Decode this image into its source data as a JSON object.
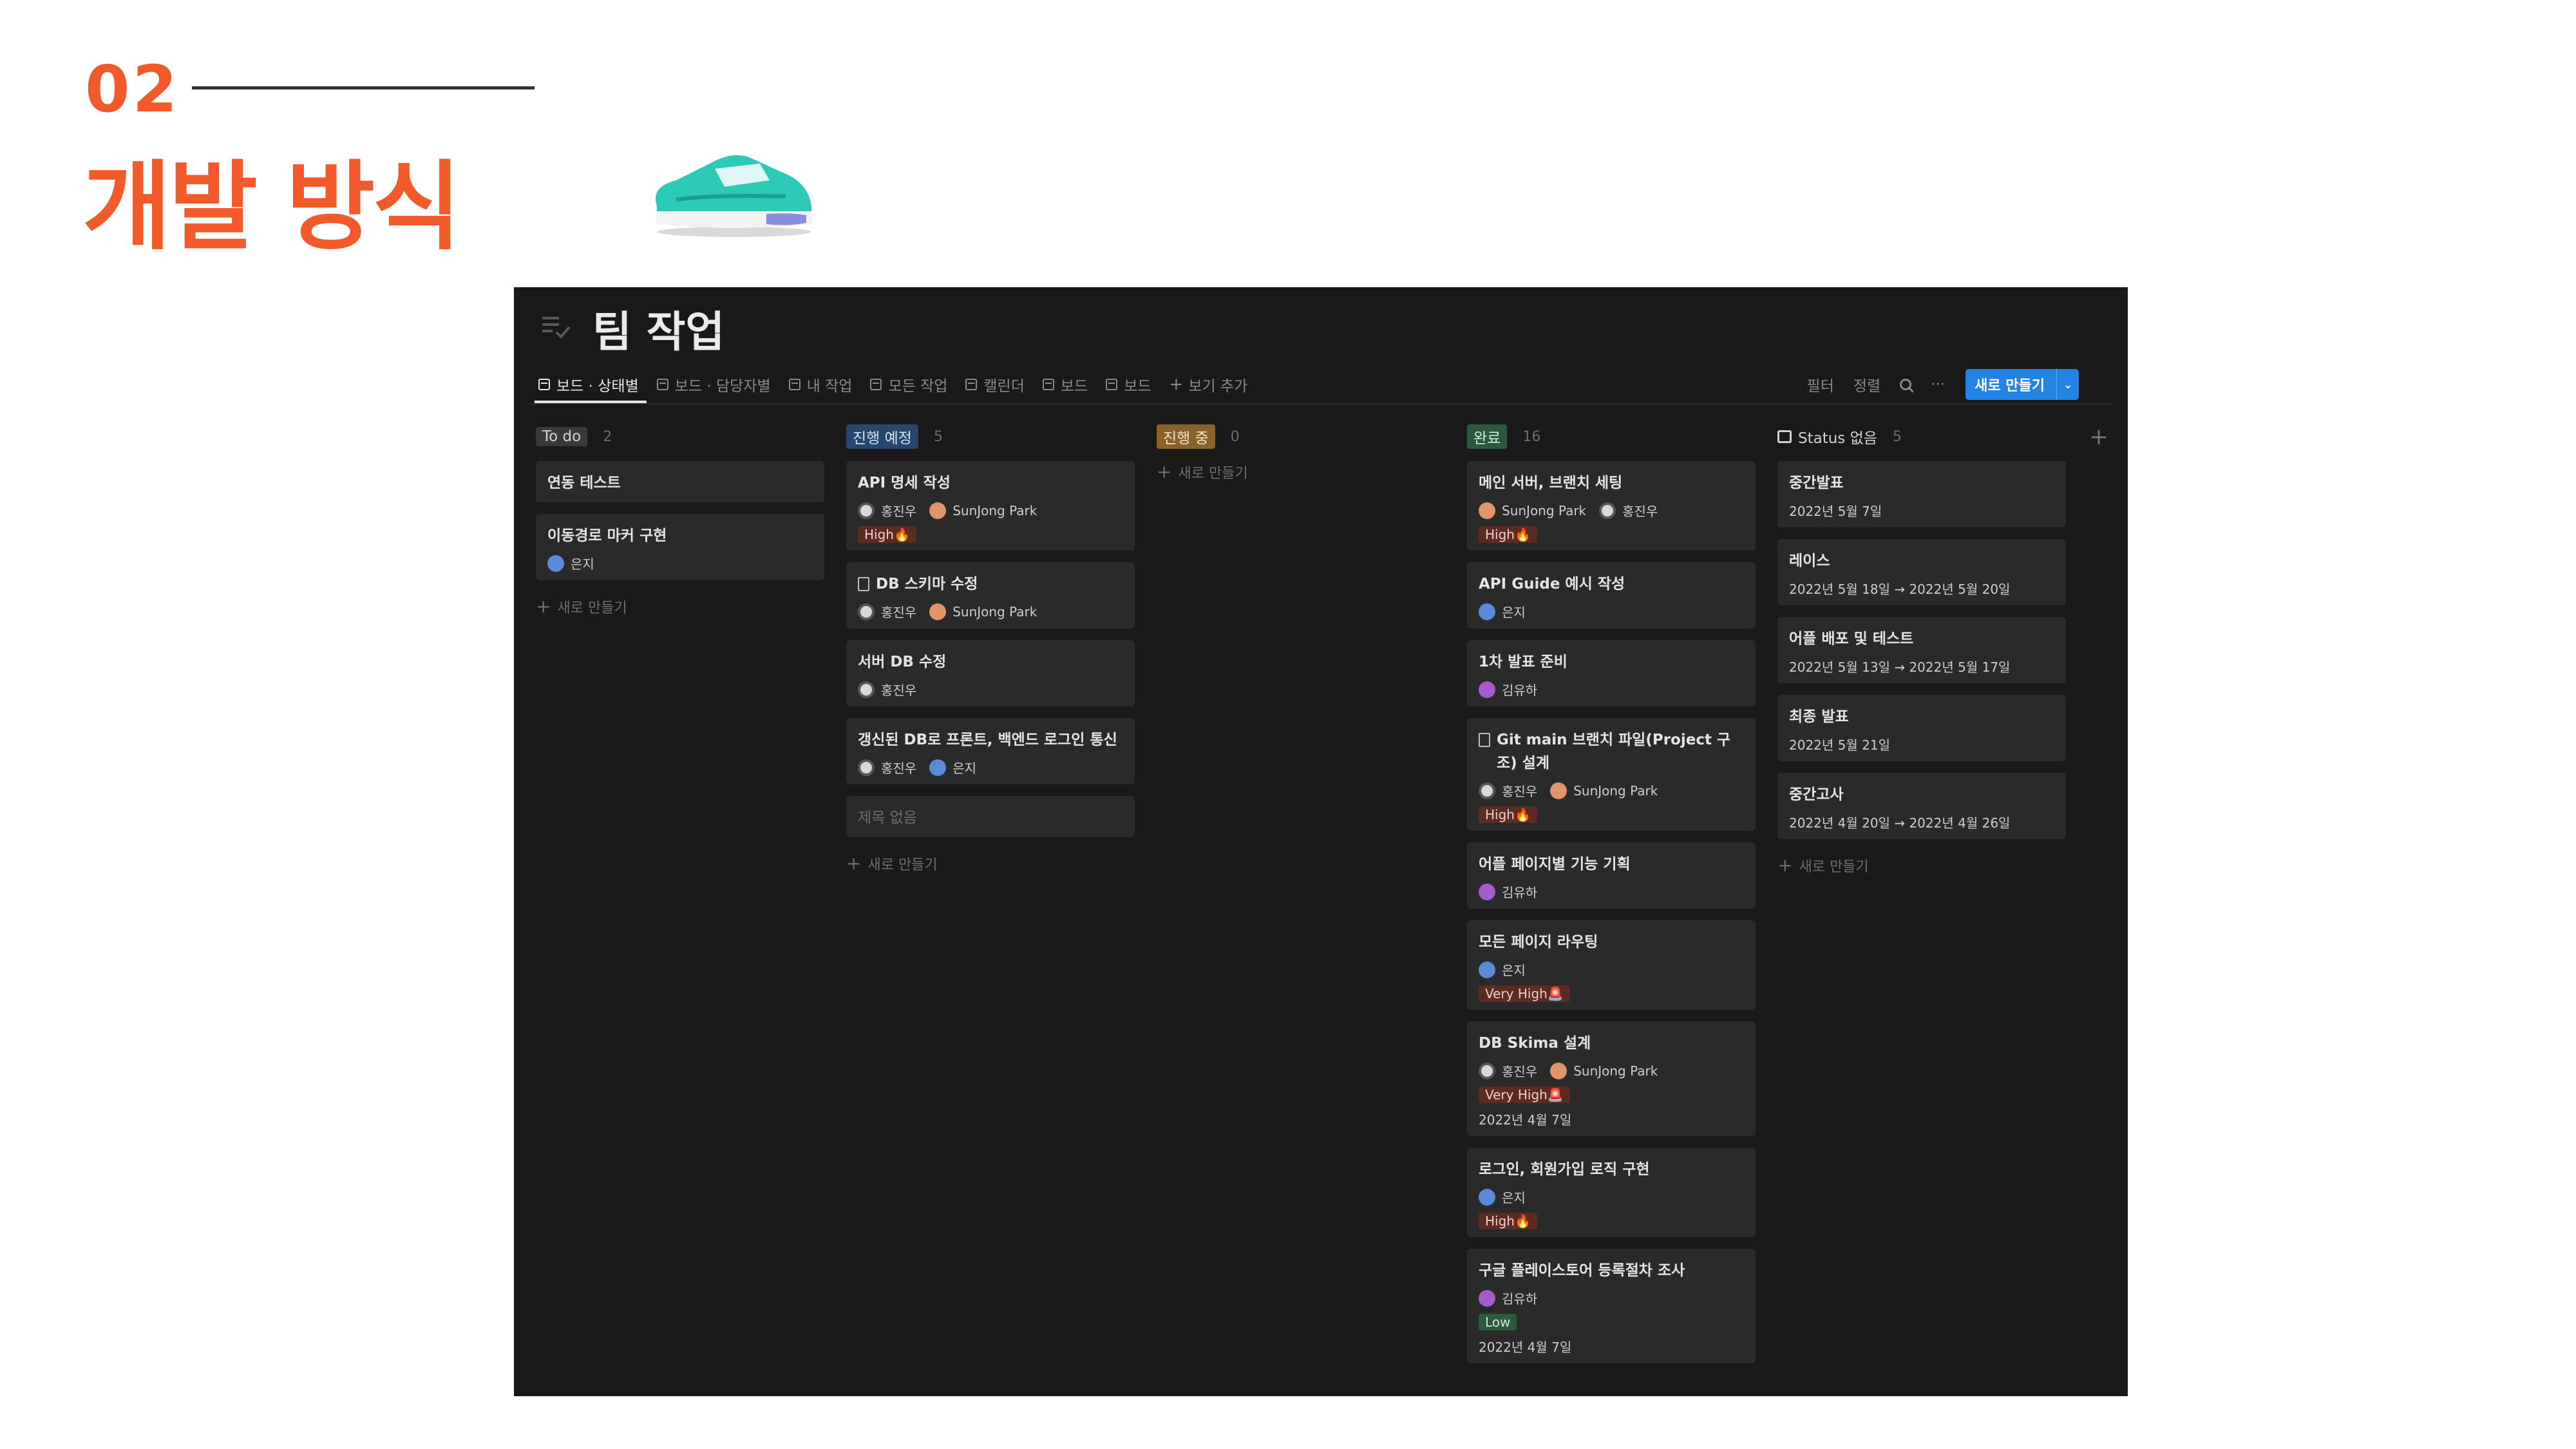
{
  "slide": {
    "number": "02",
    "title": "개발 방식"
  },
  "page": {
    "title": "팀 작업"
  },
  "tabs": [
    {
      "label": "보드 · 상태별",
      "active": true
    },
    {
      "label": "보드 · 담당자별"
    },
    {
      "label": "내 작업"
    },
    {
      "label": "모든 작업"
    },
    {
      "label": "캘린더"
    },
    {
      "label": "보드"
    },
    {
      "label": "보드"
    },
    {
      "label": "보기 추가"
    }
  ],
  "toolbar": {
    "filter": "필터",
    "sort": "정렬",
    "more": "···",
    "new": "새로 만들기"
  },
  "new_item_label": "새로 만들기",
  "colors": {
    "accent": "#f25a2c",
    "button": "#2383e2",
    "background": "#191919",
    "card": "#2a2a2a"
  },
  "columns": [
    {
      "label": "To do",
      "count": "2",
      "tag_bg": "#3a3a3a",
      "tag_fg": "#d4d4d4",
      "cards": [
        {
          "title": "연동 테스트"
        },
        {
          "title": "이동경로 마커 구현",
          "people": [
            {
              "name": "은지",
              "avatar": "eunji"
            }
          ]
        }
      ]
    },
    {
      "label": "진행 예정",
      "count": "5",
      "tag_bg": "#28456c",
      "tag_fg": "#d6e4f4",
      "cards": [
        {
          "title": "API 명세 작성",
          "people": [
            {
              "name": "홍진우",
              "avatar": "hong"
            },
            {
              "name": "SunJong Park",
              "avatar": "park"
            }
          ],
          "priority": "High🔥"
        },
        {
          "title": "DB 스키마 수정",
          "doc": true,
          "people": [
            {
              "name": "홍진우",
              "avatar": "hong"
            },
            {
              "name": "SunJong Park",
              "avatar": "park"
            }
          ]
        },
        {
          "title": "서버 DB 수정",
          "people": [
            {
              "name": "홍진우",
              "avatar": "hong"
            }
          ]
        },
        {
          "title": "갱신된 DB로 프론트, 백엔드 로그인 통신",
          "people": [
            {
              "name": "홍진우",
              "avatar": "hong"
            },
            {
              "name": "은지",
              "avatar": "eunji"
            }
          ]
        },
        {
          "title": "제목 없음",
          "empty": true
        }
      ]
    },
    {
      "label": "진행 중",
      "count": "0",
      "tag_bg": "#89632a",
      "tag_fg": "#f4e6cc",
      "cards": []
    },
    {
      "label": "완료",
      "count": "16",
      "tag_bg": "#2b593f",
      "tag_fg": "#d0ecd8",
      "cards": [
        {
          "title": "메인 서버, 브랜치 세팅",
          "people": [
            {
              "name": "SunJong Park",
              "avatar": "park"
            },
            {
              "name": "홍진우",
              "avatar": "hong"
            }
          ],
          "priority": "High🔥"
        },
        {
          "title": "API Guide 예시 작성",
          "people": [
            {
              "name": "은지",
              "avatar": "eunji"
            }
          ]
        },
        {
          "title": "1차 발표 준비",
          "people": [
            {
              "name": "김유하",
              "avatar": "kim"
            }
          ]
        },
        {
          "title": "Git main 브랜치 파일(Project 구조) 설계",
          "doc": true,
          "people": [
            {
              "name": "홍진우",
              "avatar": "hong"
            },
            {
              "name": "SunJong Park",
              "avatar": "park"
            }
          ],
          "priority": "High🔥"
        },
        {
          "title": "어플 페이지별 기능 기획",
          "people": [
            {
              "name": "김유하",
              "avatar": "kim"
            }
          ]
        },
        {
          "title": "모든 페이지 라우팅",
          "people": [
            {
              "name": "은지",
              "avatar": "eunji"
            }
          ],
          "priority": "Very High🚨"
        },
        {
          "title": "DB Skima 설계",
          "people": [
            {
              "name": "홍진우",
              "avatar": "hong"
            },
            {
              "name": "SunJong Park",
              "avatar": "park"
            }
          ],
          "priority": "Very High🚨",
          "date": "2022년 4월 7일"
        },
        {
          "title": "로그인, 회원가입 로직 구현",
          "people": [
            {
              "name": "은지",
              "avatar": "eunji"
            }
          ],
          "priority": "High🔥"
        },
        {
          "title": "구글 플레이스토어 등록절차 조사",
          "people": [
            {
              "name": "김유하",
              "avatar": "kim"
            }
          ],
          "priority": "Low",
          "priority_low": true,
          "date": "2022년 4월 7일"
        }
      ]
    },
    {
      "label": "Status 없음",
      "count": "5",
      "plain": true,
      "cards": [
        {
          "title": "중간발표",
          "date": "2022년 5월 7일"
        },
        {
          "title": "레이스",
          "date": "2022년 5월 18일 → 2022년 5월 20일"
        },
        {
          "title": "어플 배포 및 테스트",
          "date": "2022년 5월 13일 → 2022년 5월 17일"
        },
        {
          "title": "최종 발표",
          "date": "2022년 5월 21일"
        },
        {
          "title": "중간고사",
          "date": "2022년 4월 20일 → 2022년 4월 26일"
        }
      ]
    }
  ]
}
